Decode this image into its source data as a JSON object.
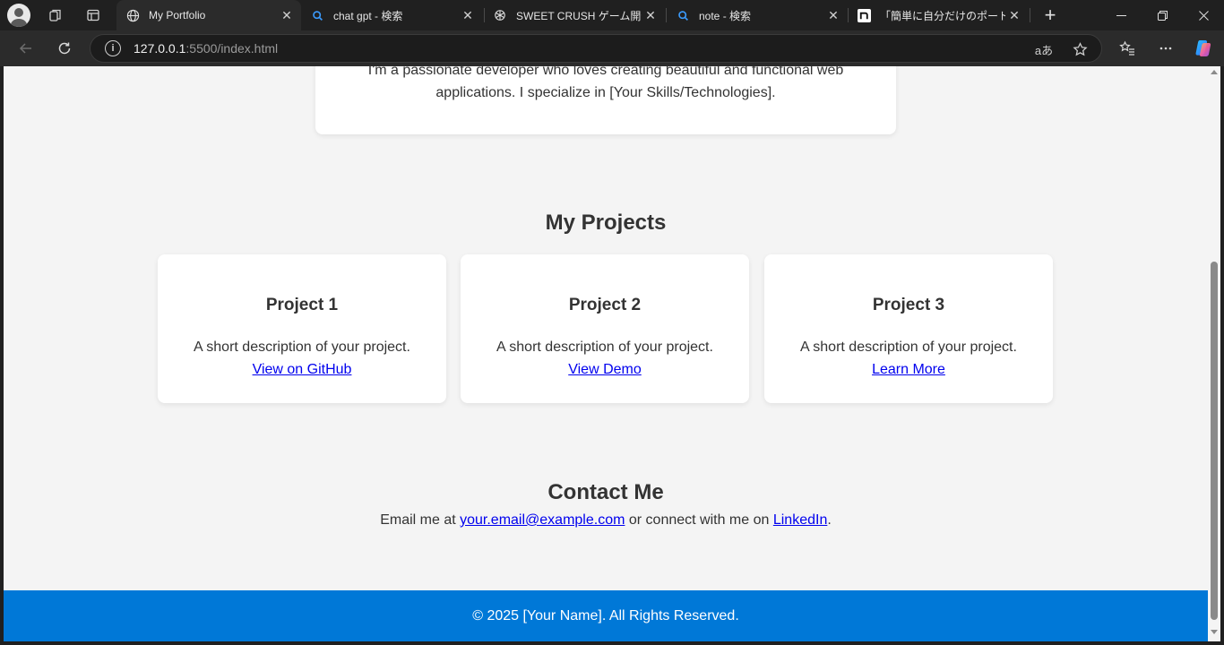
{
  "browser": {
    "tabs": [
      {
        "title": "My Portfolio",
        "favicon": "globe-icon",
        "active": true
      },
      {
        "title": "chat gpt - 検索",
        "favicon": "search-icon",
        "active": false
      },
      {
        "title": "SWEET CRUSH ゲーム開発",
        "favicon": "openai-icon",
        "active": false
      },
      {
        "title": "note - 検索",
        "favicon": "search-icon",
        "active": false
      },
      {
        "title": "「簡単に自分だけのポートフォリ",
        "favicon": "note-icon",
        "active": false
      }
    ],
    "close_glyph": "✕",
    "new_tab_glyph": "+",
    "url_host": "127.0.0.1",
    "url_rest": ":5500/index.html",
    "read_aloud_glyph": "aあ"
  },
  "page": {
    "about_text": "I'm a passionate developer who loves creating beautiful and functional web applications. I specialize in [Your Skills/Technologies].",
    "projects_title": "My Projects",
    "projects": [
      {
        "title": "Project 1",
        "description": "A short description of your project.",
        "link": "View on GitHub"
      },
      {
        "title": "Project 2",
        "description": "A short description of your project.",
        "link": "View Demo"
      },
      {
        "title": "Project 3",
        "description": "A short description of your project.",
        "link": "Learn More"
      }
    ],
    "contact_title": "Contact Me",
    "contact_prefix": "Email me at ",
    "contact_email": "your.email@example.com",
    "contact_middle": " or connect with me on ",
    "contact_linkedin": "LinkedIn",
    "contact_suffix": ".",
    "footer_text": "© 2025 [Your Name]. All Rights Reserved."
  },
  "colors": {
    "accent": "#0078d7",
    "link": "#0000ee",
    "page_bg": "#f4f4f4"
  }
}
